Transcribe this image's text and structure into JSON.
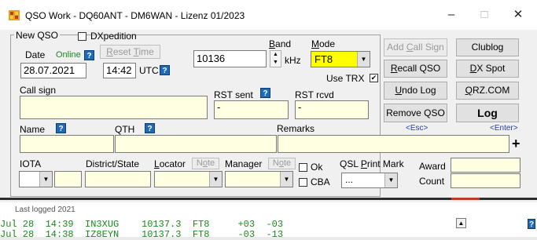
{
  "window": {
    "title": "QSO Work - DQ60ANT - DM6WAN - Lizenz 01/2023",
    "minimize": "–",
    "maximize": "□",
    "close": "✕"
  },
  "group": {
    "legend": "New QSO",
    "dxpedition_label": "DXpedition"
  },
  "date": {
    "label": "Date",
    "online": "Online",
    "help": "?",
    "reset_time": "Reset Time",
    "value": "28.07.2021",
    "time": "14:42",
    "utc": "UTC",
    "utc_help": "?"
  },
  "band": {
    "label": "Band",
    "value": "10136",
    "unit": "kHz"
  },
  "mode": {
    "label": "Mode",
    "value": "FT8",
    "use_trx": "Use TRX",
    "use_trx_checked": "✔"
  },
  "buttons": {
    "add_call_sign": "Add Call Sign",
    "clublog": "Clublog",
    "recall_qso": "Recall QSO",
    "dx_spot": "DX Spot",
    "undo_log": "Undo Log",
    "qrz": "QRZ.COM",
    "remove_qso": "Remove QSO",
    "log": "Log",
    "esc_hint": "<Esc>",
    "enter_hint": "<Enter>",
    "plus": "+"
  },
  "fields": {
    "call_sign_label": "Call sign",
    "call_sign_value": "",
    "rst_sent_label": "RST sent",
    "rst_sent_help": "?",
    "rst_sent_value": "-",
    "rst_rcvd_label": "RST rcvd",
    "rst_rcvd_value": "-",
    "name_label": "Name",
    "name_help": "?",
    "qth_label": "QTH",
    "qth_help": "?",
    "remarks_label": "Remarks",
    "iota_label": "IOTA",
    "district_label": "District/State",
    "locator_label": "Locator",
    "note": "Note",
    "manager_label": "Manager",
    "ok_label": "Ok",
    "cba_label": "CBA",
    "qsl_print_label": "QSL Print Mark",
    "qsl_print_value": "...",
    "award_label": "Award",
    "count_label": "Count"
  },
  "log": {
    "header": "Last logged 2021",
    "lines": [
      "Jul 28  14:39  IN3XUG    10137.3  FT8     +03  -03",
      "Jul 28  14:38  IZ8EYN    10137.3  FT8     -03  -13"
    ],
    "help": "?"
  },
  "colors": {
    "mode_bg": "#ffff00",
    "field_bg": "#ffffe1",
    "online_text": "#1a8a1a",
    "help_icon": "#1e6ab8",
    "hint_text": "#1f3fb0",
    "log_text": "#1a8a1a"
  }
}
